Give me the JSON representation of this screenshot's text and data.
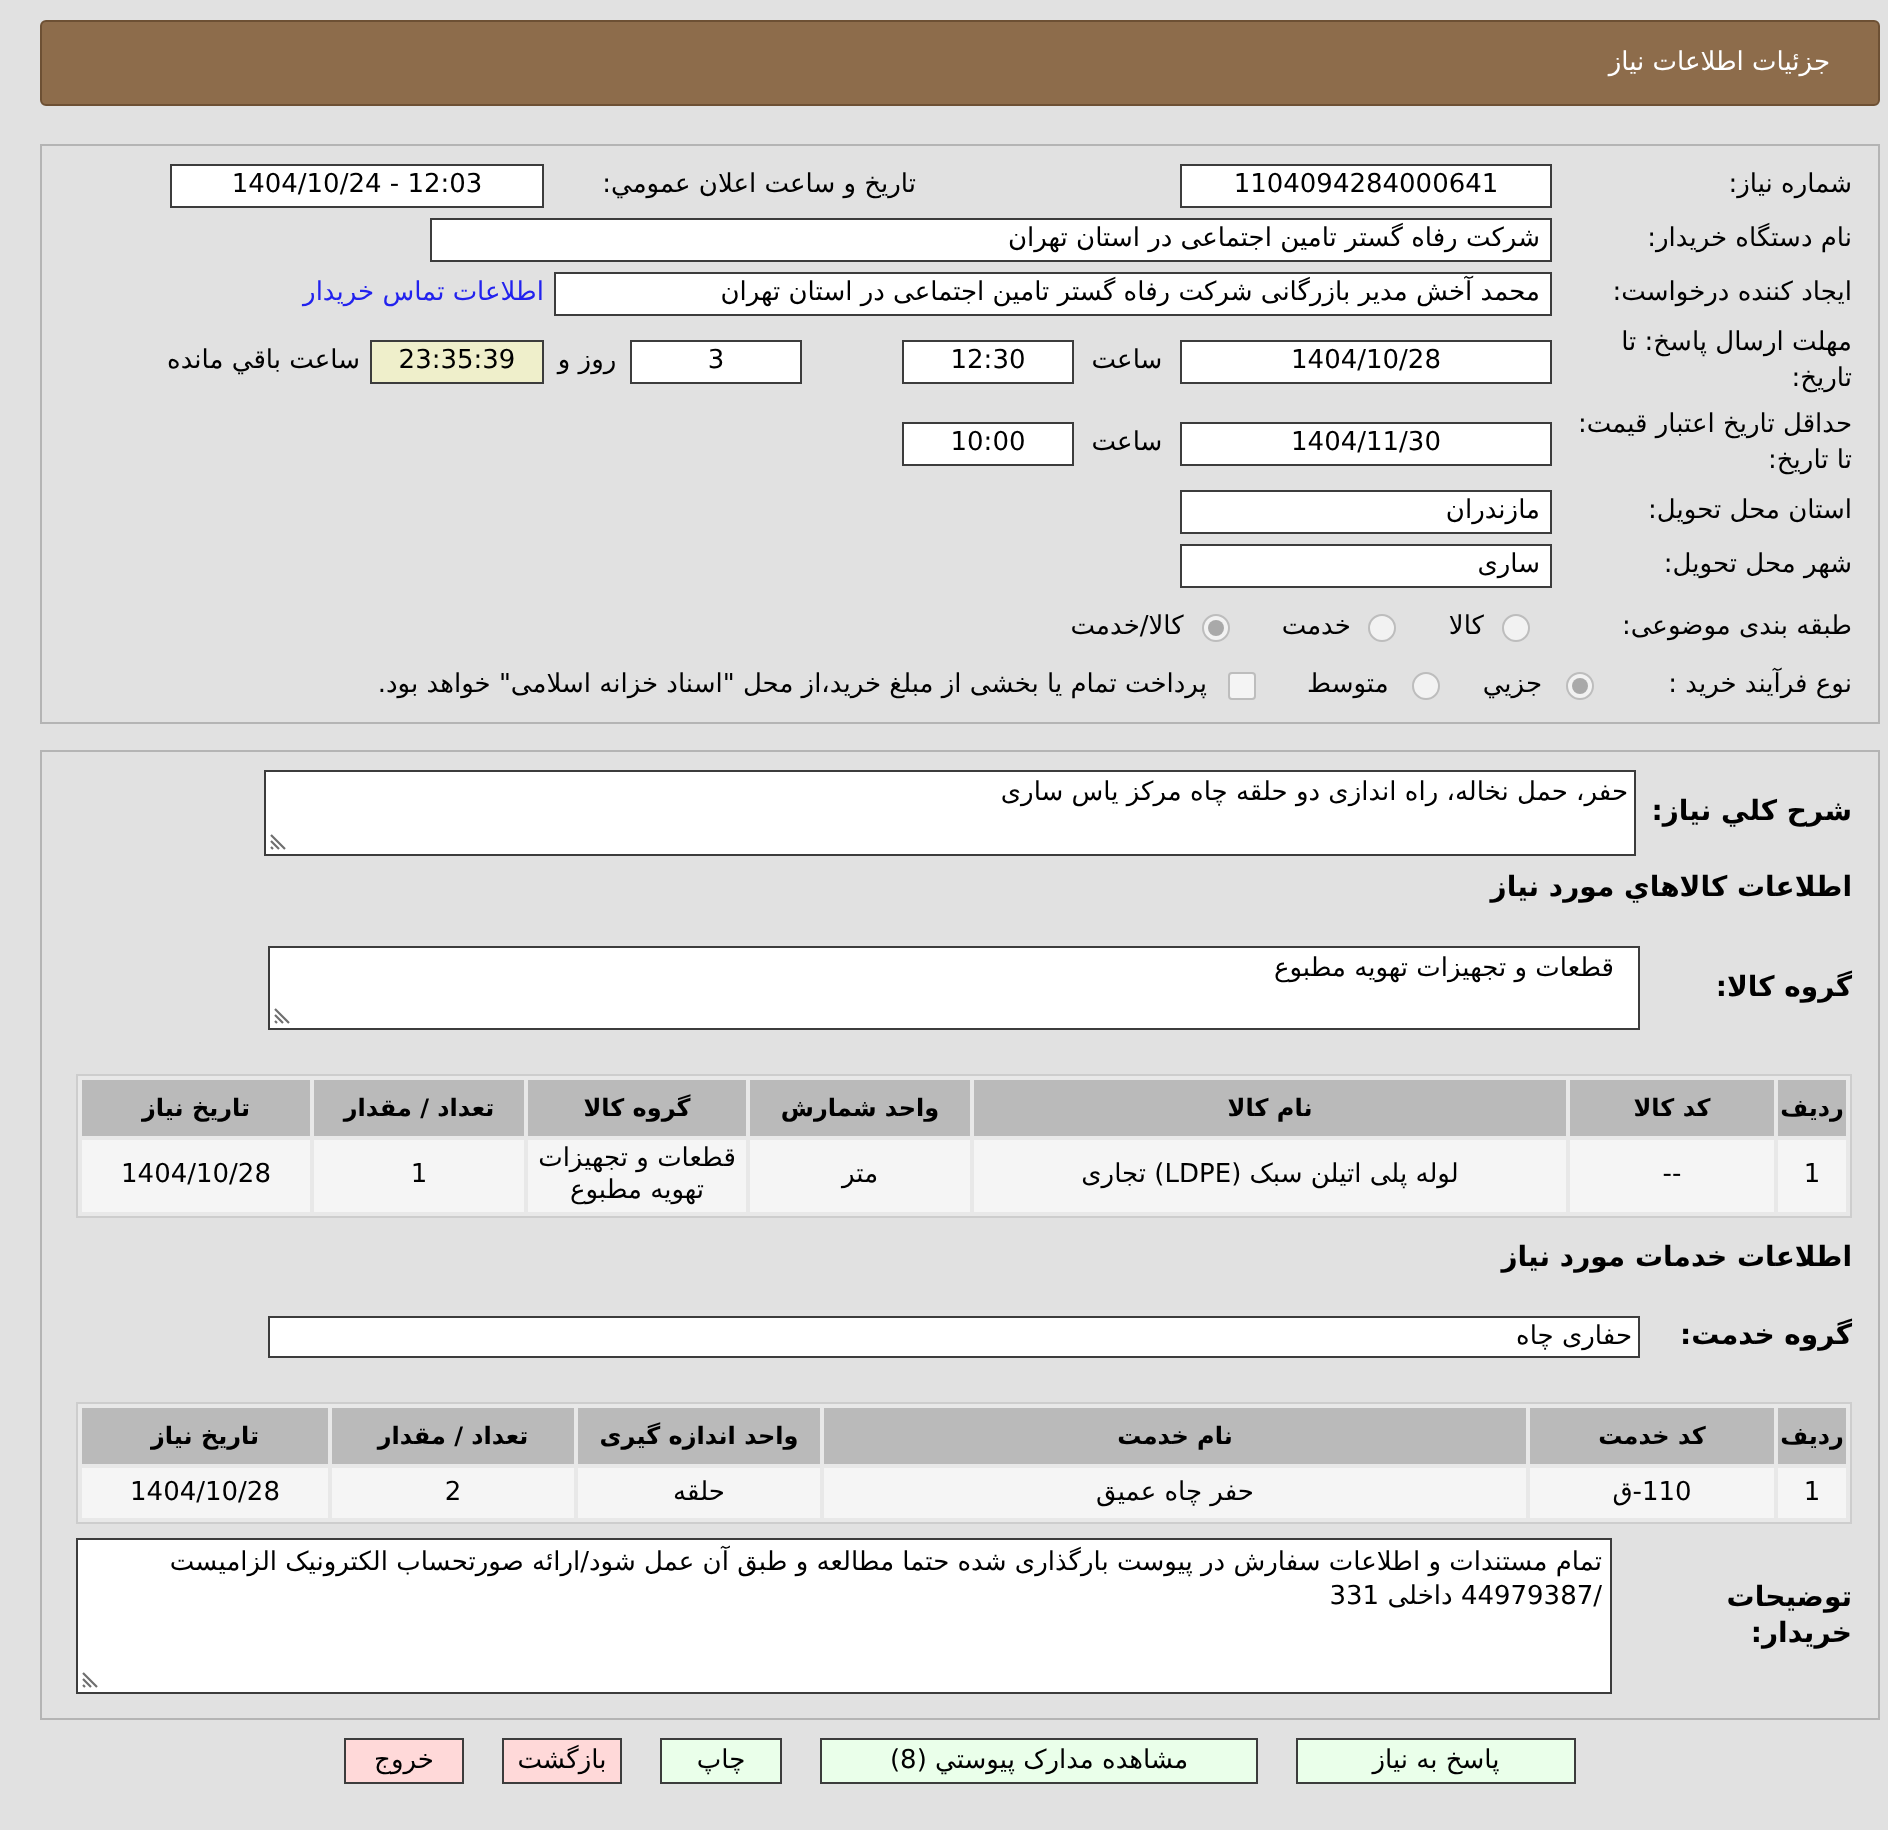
{
  "header": {
    "title": "جزئیات اطلاعات نیاز"
  },
  "details": {
    "need_number": {
      "label": "شماره نیاز:",
      "value": "1104094284000641"
    },
    "announcement": {
      "label": "تاريخ و ساعت اعلان عمومي:",
      "value": "1404/10/24 - 12:03"
    },
    "buyer": {
      "label": "نام دستگاه خریدار:",
      "value": "شرکت رفاه گستر تامین اجتماعی در استان تهران"
    },
    "requester": {
      "label": "ایجاد کننده درخواست:",
      "value": "محمد آخش مدیر بازرگانی شرکت رفاه گستر تامین اجتماعی در استان تهران",
      "contact_link": "اطلاعات تماس خریدار"
    },
    "response_deadline": {
      "label": "مهلت ارسال پاسخ: تا تاریخ:",
      "date": "1404/10/28",
      "time_label": "ساعت",
      "time": "12:30",
      "days": "3",
      "days_label": "روز و",
      "remaining": "23:35:39",
      "remaining_label": "ساعت باقي مانده"
    },
    "price_validity": {
      "label": "حداقل تاریخ اعتبار قیمت: تا تاریخ:",
      "date": "1404/11/30",
      "time_label": "ساعت",
      "time": "10:00"
    },
    "delivery_province": {
      "label": "استان محل تحویل:",
      "value": "مازندران"
    },
    "delivery_city": {
      "label": "شهر محل تحویل:",
      "value": "ساری"
    },
    "category": {
      "label": "طبقه بندی موضوعی:",
      "options": [
        {
          "label": "کالا",
          "selected": false
        },
        {
          "label": "خدمت",
          "selected": false
        },
        {
          "label": "کالا/خدمت",
          "selected": true
        }
      ]
    },
    "purchase_type": {
      "label": "نوع فرآیند خرید :",
      "options": [
        {
          "label": "جزيي",
          "selected": true
        },
        {
          "label": "متوسط",
          "selected": false
        }
      ],
      "treasury_option": {
        "label": "پرداخت تمام یا بخشی از مبلغ خرید،از محل \"اسناد خزانه اسلامی\" خواهد بود.",
        "checked": false
      }
    }
  },
  "requirements": {
    "summary": {
      "label": "شرح کلي نياز:",
      "value": "حفر، حمل نخاله، راه اندازی دو حلقه چاه مرکز یاس ساری"
    },
    "goods_heading": "اطلاعات کالاهاي مورد نياز",
    "goods_group": {
      "label": "گروه کالا:",
      "value": "قطعات و تجهیزات تهویه مطبوع"
    },
    "goods_table": {
      "columns": [
        "ردیف",
        "کد کالا",
        "نام کالا",
        "واحد شمارش",
        "گروه کالا",
        "تعداد / مقدار",
        "تاریخ نیاز"
      ],
      "rows": [
        [
          "1",
          "--",
          "لوله پلی اتیلن سبک (LDPE) تجاری",
          "متر",
          "قطعات و تجهیزات تهویه مطبوع",
          "1",
          "1404/10/28"
        ]
      ]
    },
    "services_heading": "اطلاعات خدمات مورد نیاز",
    "service_group": {
      "label": "گروه خدمت:",
      "value": "حفاری چاه"
    },
    "services_table": {
      "columns": [
        "ردیف",
        "کد خدمت",
        "نام خدمت",
        "واحد اندازه گیری",
        "تعداد / مقدار",
        "تاریخ نیاز"
      ],
      "rows": [
        [
          "1",
          "110-ق",
          "حفر چاه عمیق",
          "حلقه",
          "2",
          "1404/10/28"
        ]
      ]
    },
    "buyer_notes": {
      "label": "توضیحات خریدار:",
      "value": "تمام مستندات و اطلاعات سفارش در پیوست بارگذاری شده حتما مطالعه و طبق آن عمل شود/ارائه صورتحساب الکترونیک الزامیست /44979387 داخلی 331"
    }
  },
  "buttons": [
    {
      "label": "پاسخ به نیاز",
      "kind": "confirm"
    },
    {
      "label": "مشاهده مدارک پیوستي (8)",
      "kind": "confirm"
    },
    {
      "label": "چاپ",
      "kind": "confirm"
    },
    {
      "label": "بازگشت",
      "kind": "cancel"
    },
    {
      "label": "خروج",
      "kind": "cancel"
    }
  ]
}
